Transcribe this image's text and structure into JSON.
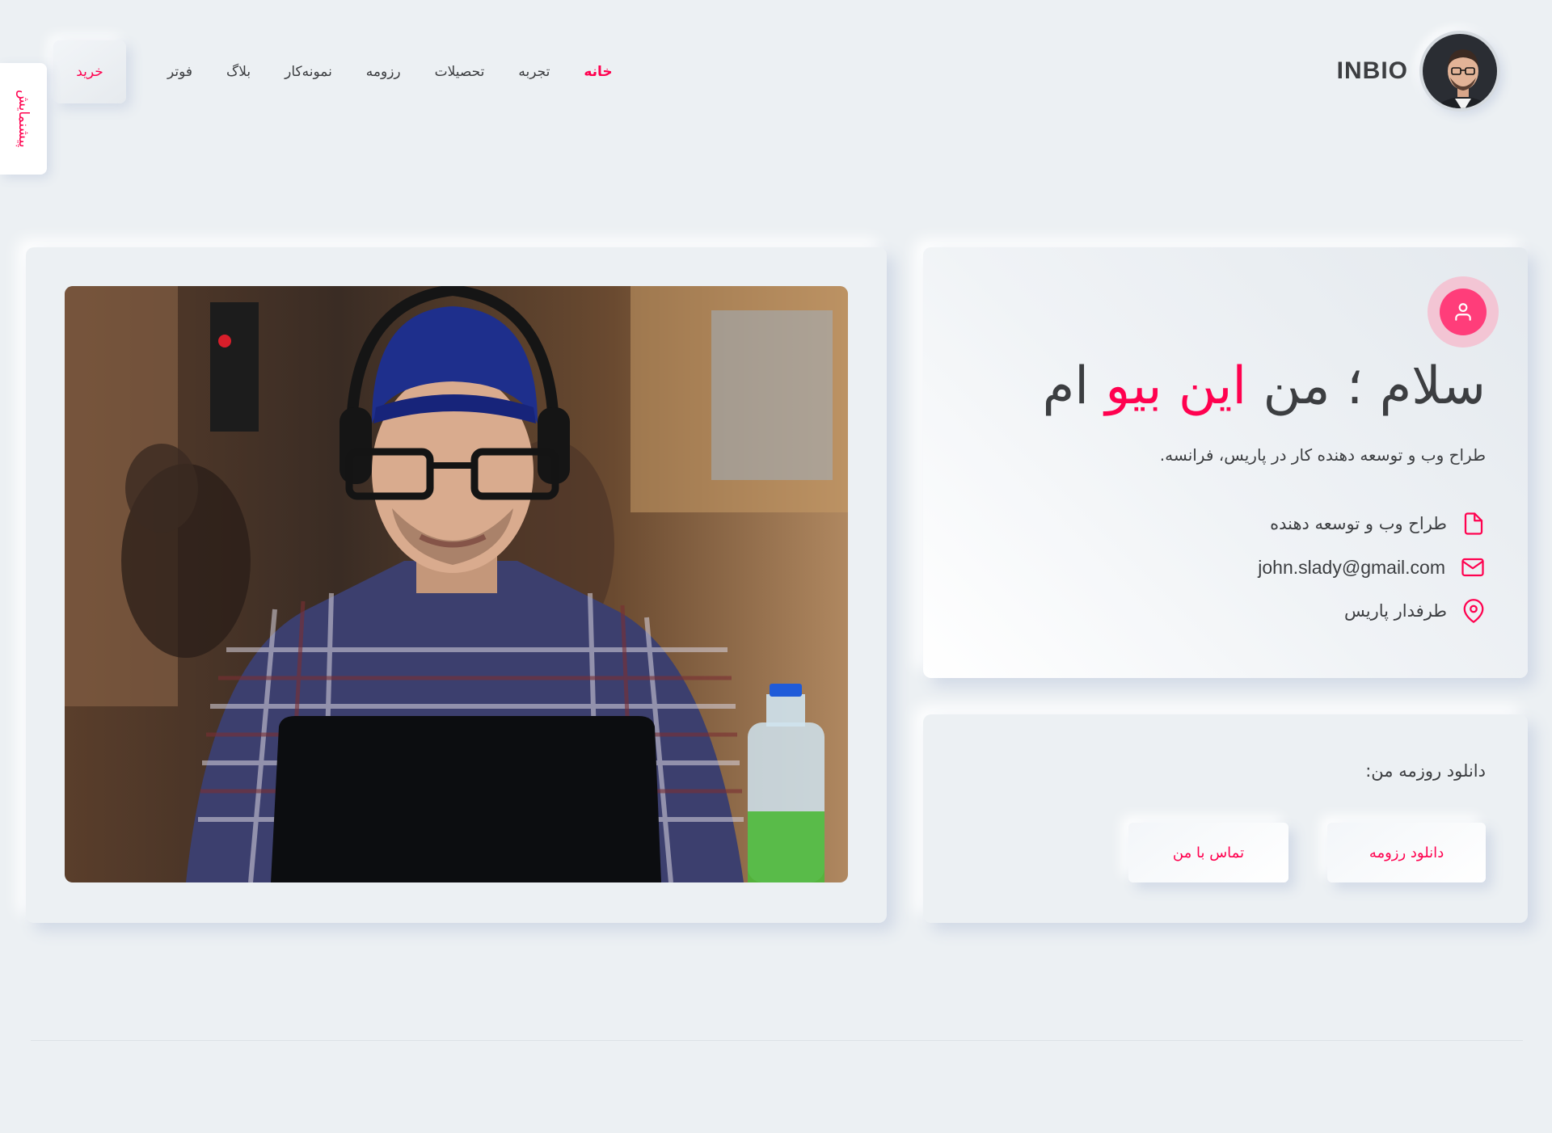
{
  "brand": {
    "name": "INBIO"
  },
  "nav": {
    "items": [
      "خانه",
      "تجربه",
      "تحصیلات",
      "رزومه",
      "نمونه‌کار",
      "بلاگ",
      "فوتر"
    ],
    "active": "خانه",
    "buy_label": "خرید"
  },
  "demo_tab": {
    "label": "پیشنمایش"
  },
  "hero": {
    "headline_part1": "سلام ؛ من",
    "headline_name": "این بیو",
    "headline_part2": "ام",
    "subtitle": "طراح وب و توسعه دهنده کار در پاریس، فرانسه.",
    "details": [
      {
        "icon": "file-icon",
        "text": "طراح وب و توسعه دهنده"
      },
      {
        "icon": "mail-icon",
        "text": "john.slady@gmail.com"
      },
      {
        "icon": "map-pin-icon",
        "text": "طرفدار پاریس"
      }
    ]
  },
  "download": {
    "title": "دانلود روزمه من:",
    "resume_button": "دانلود رزومه",
    "contact_button": "تماس با من"
  },
  "colors": {
    "accent": "#ff014f",
    "background": "#ecf0f3",
    "text": "#3c3e41"
  }
}
